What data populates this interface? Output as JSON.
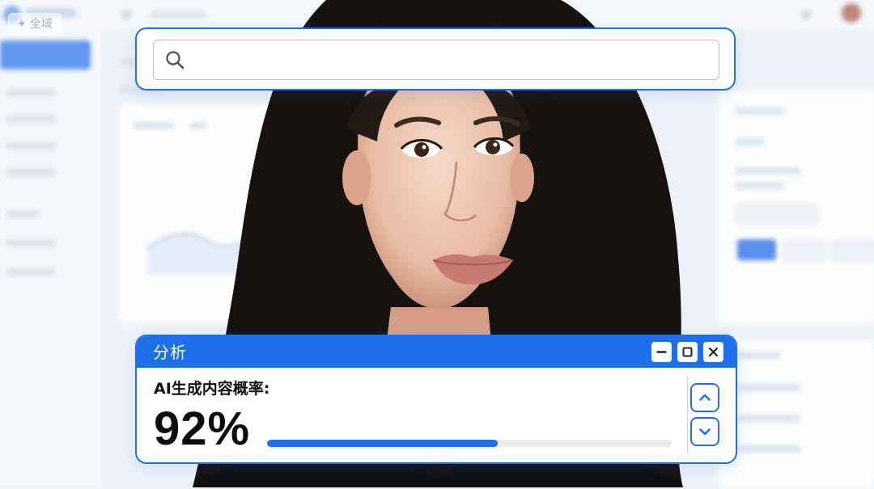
{
  "chip": {
    "label": "全域"
  },
  "search": {
    "value": "",
    "placeholder": ""
  },
  "analysis": {
    "title": "分析",
    "metric_label": "AI生成内容概率:",
    "metric_value": "92%",
    "progress_fraction": 0.57
  },
  "icons": {
    "search": "search-icon",
    "minimize": "minimize-icon",
    "maximize": "maximize-icon",
    "close": "close-icon",
    "up": "chevron-up-icon",
    "down": "chevron-down-icon"
  },
  "colors": {
    "accent": "#1f6fea",
    "track": "#ececec",
    "text": "#111111"
  }
}
